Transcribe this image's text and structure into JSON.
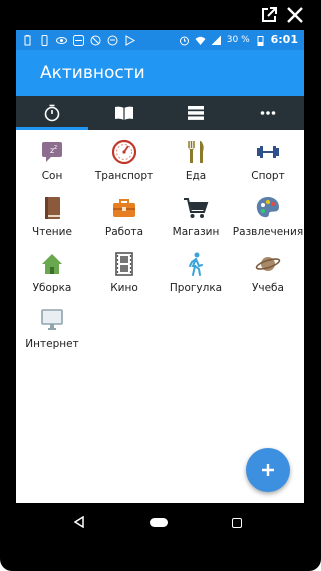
{
  "status_bar": {
    "battery_percent": "30 %",
    "time": "6:01"
  },
  "app_bar": {
    "title": "Активности"
  },
  "tabs": [
    {
      "icon": "stopwatch-icon",
      "selected": true
    },
    {
      "icon": "book-icon",
      "selected": false
    },
    {
      "icon": "list-icon",
      "selected": false
    },
    {
      "icon": "more-icon",
      "selected": false
    }
  ],
  "activities": [
    {
      "label": "Сон",
      "icon": "sleep-icon"
    },
    {
      "label": "Транспорт",
      "icon": "speedometer-icon"
    },
    {
      "label": "Еда",
      "icon": "fork-knife-icon"
    },
    {
      "label": "Спорт",
      "icon": "dumbbell-icon"
    },
    {
      "label": "Чтение",
      "icon": "book-icon"
    },
    {
      "label": "Работа",
      "icon": "briefcase-icon"
    },
    {
      "label": "Магазин",
      "icon": "cart-icon"
    },
    {
      "label": "Развлечения",
      "icon": "palette-icon"
    },
    {
      "label": "Уборка",
      "icon": "house-icon"
    },
    {
      "label": "Кино",
      "icon": "film-icon"
    },
    {
      "label": "Прогулка",
      "icon": "walk-icon"
    },
    {
      "label": "Учеба",
      "icon": "planet-icon"
    },
    {
      "label": "Интернет",
      "icon": "monitor-icon"
    }
  ],
  "colors": {
    "status_bar": "#1e88e5",
    "app_bar": "#2196f3",
    "tab_bar": "#263238",
    "fab": "#3d8fdf"
  }
}
